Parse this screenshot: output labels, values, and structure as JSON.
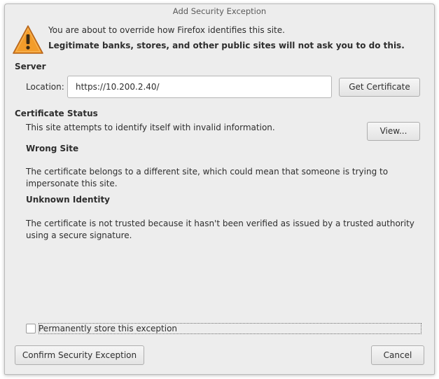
{
  "window": {
    "title": "Add Security Exception"
  },
  "intro": {
    "line1": "You are about to override how Firefox identifies this site.",
    "line2": "Legitimate banks, stores, and other public sites will not ask you to do this.",
    "icon": "warning-triangle-icon"
  },
  "server": {
    "title": "Server",
    "location_label": "Location:",
    "location_value": "https://10.200.2.40/",
    "get_certificate_label": "Get Certificate"
  },
  "certificate_status": {
    "title": "Certificate Status",
    "summary": "This site attempts to identify itself with invalid information.",
    "view_label": "View...",
    "wrong_site_title": "Wrong Site",
    "wrong_site_desc": "The certificate belongs to a different site, which could mean that someone is trying to impersonate this site.",
    "unknown_identity_title": "Unknown Identity",
    "unknown_identity_desc": "The certificate is not trusted because it hasn't been verified as issued by a trusted authority using a secure signature."
  },
  "permanent": {
    "label": "Permanently store this exception",
    "checked": false
  },
  "footer": {
    "confirm_label": "Confirm Security Exception",
    "cancel_label": "Cancel"
  },
  "colors": {
    "warning_fill": "#f39c2a",
    "warning_stroke": "#b5651d"
  }
}
